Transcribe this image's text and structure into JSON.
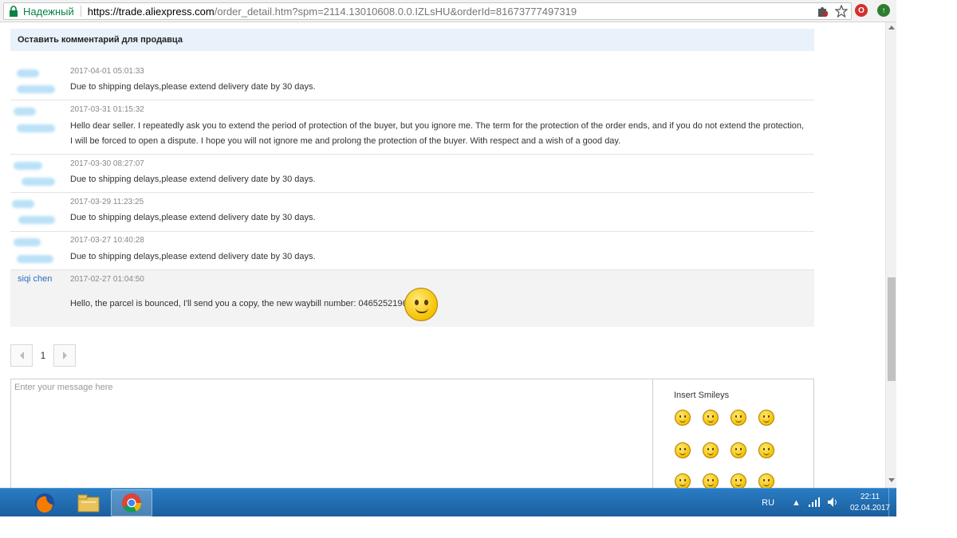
{
  "browser": {
    "secure_label": "Надежный",
    "url_host": "https://trade.aliexpress.com",
    "url_rest": "/order_detail.htm?spm=2114.13010608.0.0.IZLsHU&orderId=81673777497319"
  },
  "comments": {
    "header": "Оставить комментарий для продавца",
    "messages": [
      {
        "time": "2017-04-01 05:01:33",
        "text": "Due to shipping delays,please extend delivery date by 30 days."
      },
      {
        "time": "2017-03-31 01:15:32",
        "text": "Hello dear seller. I repeatedly ask you to extend the period of protection of the buyer, but you ignore me. The term for the protection of the order ends, and if you do not extend the protection, I will be forced to open a dispute. I hope you will not ignore me and prolong the protection of the buyer. With respect and a wish of a good day."
      },
      {
        "time": "2017-03-30 08:27:07",
        "text": "Due to shipping delays,please extend delivery date by 30 days."
      },
      {
        "time": "2017-03-29 11:23:25",
        "text": "Due to shipping delays,please extend delivery date by 30 days."
      },
      {
        "time": "2017-03-27 10:40:28",
        "text": "Due to shipping delays,please extend delivery date by 30 days."
      },
      {
        "sender": "siqi chen",
        "time": "2017-02-27 01:04:50",
        "text": "Hello, the parcel is bounced, I'll send you a copy, the new waybill number: 04652521961"
      }
    ]
  },
  "pager": {
    "current": "1"
  },
  "compose": {
    "placeholder": "Enter your message here",
    "smileys_title": "Insert Smileys"
  },
  "taskbar": {
    "lang": "RU",
    "time": "22:11",
    "date": "02.04.2017",
    "apps": [
      "firefox-icon",
      "file-explorer-icon",
      "chrome-icon"
    ]
  }
}
